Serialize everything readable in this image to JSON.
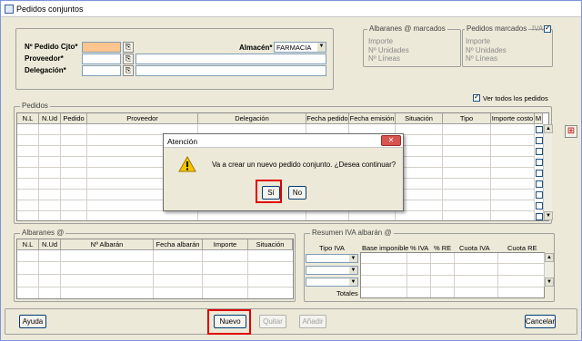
{
  "window": {
    "title": "Pedidos conjuntos"
  },
  "form": {
    "pedido_label": "Nº Pedido Cjto*",
    "proveedor_label": "Proveedor*",
    "delegacion_label": "Delegación*",
    "almacen_label": "Almacén*",
    "almacen_value": "FARMACIA"
  },
  "albaranes_marcados": {
    "title": "Albaranes @ marcados",
    "importe": "Importe",
    "unidades": "Nº Unidades",
    "lineas": "Nº Líneas"
  },
  "pedidos_marcados": {
    "title": "Pedidos marcados",
    "iva": "IVA",
    "importe": "Importe",
    "unidades": "Nº Unidades",
    "lineas": "Nº Líneas"
  },
  "ver_todos": "Ver todos los pedidos",
  "pedidos": {
    "title": "Pedidos",
    "columns": [
      "N.L",
      "N.Ud",
      "Pedido",
      "Proveedor",
      "Delegación",
      "Fecha pedido",
      "Fecha emisión",
      "Situación",
      "Tipo",
      "Importe costo",
      "M"
    ]
  },
  "albaranes": {
    "title": "Albaranes @",
    "columns": [
      "N.L",
      "N.Ud",
      "Nº Albarán",
      "Fecha albarán",
      "Importe",
      "Situación"
    ]
  },
  "resumen": {
    "title": "Resumen IVA albarán @",
    "columns": [
      "Tipo IVA",
      "Base imponible",
      "% IVA",
      "% RE",
      "Cuota IVA",
      "Cuota RE"
    ],
    "totales": "Totales"
  },
  "dialog": {
    "title": "Atención",
    "message": "Va a crear un nuevo pedido conjunto. ¿Desea continuar?",
    "yes": "Sí",
    "no": "No",
    "close": "✕"
  },
  "buttons": {
    "ayuda": "Ayuda",
    "nuevo": "Nuevo",
    "quitar": "Quitar",
    "anadir": "Añadir",
    "cancelar": "Cancelar"
  }
}
